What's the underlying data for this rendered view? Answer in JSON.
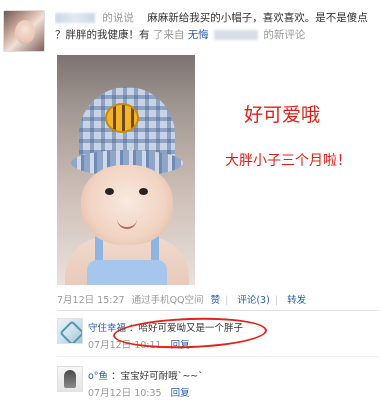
{
  "post": {
    "avatar_alt": "",
    "said": "的说说",
    "text_line1": "麻麻新给我买的小帽子，喜欢喜欢。是不是傻点",
    "text_line2": "？胖胖的我健康！有",
    "text_line2b": "了来自",
    "source_link": "无悔",
    "text_line2c": "的新评论"
  },
  "overlay": {
    "caption1": "好可爱哦",
    "caption2": "大胖小子三个月啦！"
  },
  "meta": {
    "time": "7月12日 15:27",
    "via": "通过手机QQ空间",
    "like": "赞",
    "comment": "评论(3)",
    "forward": "转发"
  },
  "comments": [
    {
      "author": "守住幸福",
      "text": "：哈好可爱呦又是一个胖子",
      "time": "07月12日 10:11",
      "reply": "回复"
    },
    {
      "author": "o°鱼",
      "text": "：宝宝好可耐哦`~~`",
      "time": "07月12日 10:35",
      "reply": "回复"
    }
  ],
  "colors": {
    "link": "#2b5ca8",
    "muted": "#999999",
    "annotation_red": "#e2231a"
  }
}
